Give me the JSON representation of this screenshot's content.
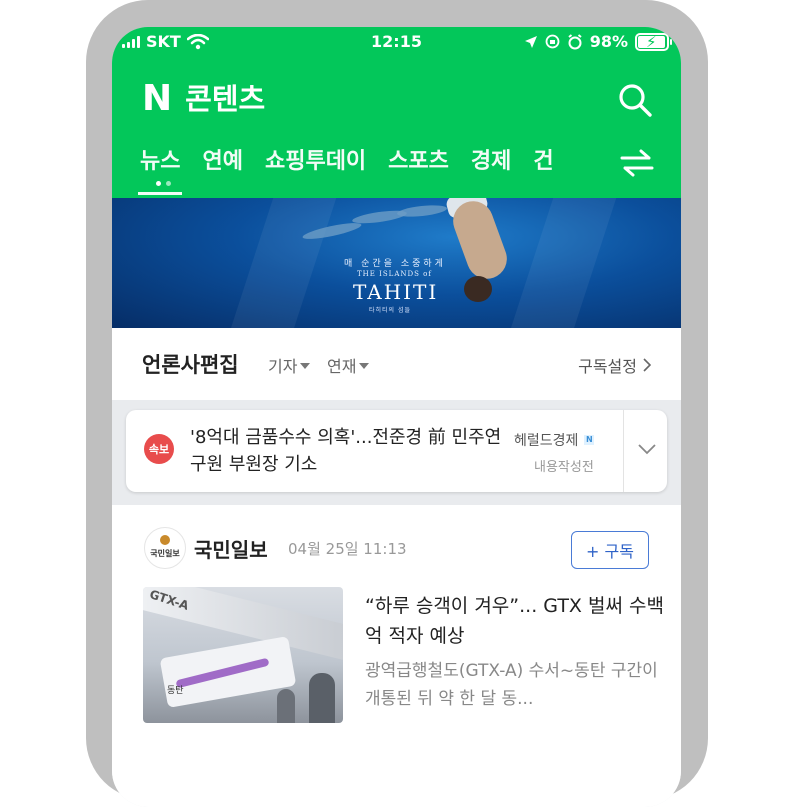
{
  "status_bar": {
    "carrier": "SKT",
    "time": "12:15",
    "battery": "98%",
    "battery_level": 0.98
  },
  "header": {
    "logo": "N",
    "title": "콘텐츠"
  },
  "tabs": [
    {
      "label": "뉴스",
      "active": true
    },
    {
      "label": "연예",
      "active": false
    },
    {
      "label": "쇼핑투데이",
      "active": false
    },
    {
      "label": "스포츠",
      "active": false
    },
    {
      "label": "경제",
      "active": false
    },
    {
      "label": "건",
      "active": false
    }
  ],
  "banner": {
    "subtitle": "매 순간을 소중하게",
    "islands": "THE ISLANDS of",
    "brand": "TAHITI",
    "caption": "타히티의 섬들"
  },
  "editor": {
    "title": "언론사편집",
    "filter_reporter": "기자",
    "filter_series": "연재",
    "settings_label": "구독설정"
  },
  "breaking": {
    "badge": "속보",
    "headline": "'8억대 금품수수 의혹'...전준경 前 민주연구원 부원장 기소",
    "source": "헤럴드경제",
    "label": "내용작성전"
  },
  "article": {
    "publisher_logo_text": "국민일보",
    "publisher": "국민일보",
    "date": "04월 25일 11:13",
    "subscribe_label": "+ 구독",
    "headline": "“하루 승객이 겨우”... GTX 벌써 수백억 적자 예상",
    "summary": "광역급행철도(GTX-A) 수서~동탄 구간이 개통된 뒤 약 한 달 동..."
  },
  "colors": {
    "brand_green": "#03c75a",
    "breaking_red": "#e84c4c",
    "subscribe_blue": "#2f63c8"
  }
}
